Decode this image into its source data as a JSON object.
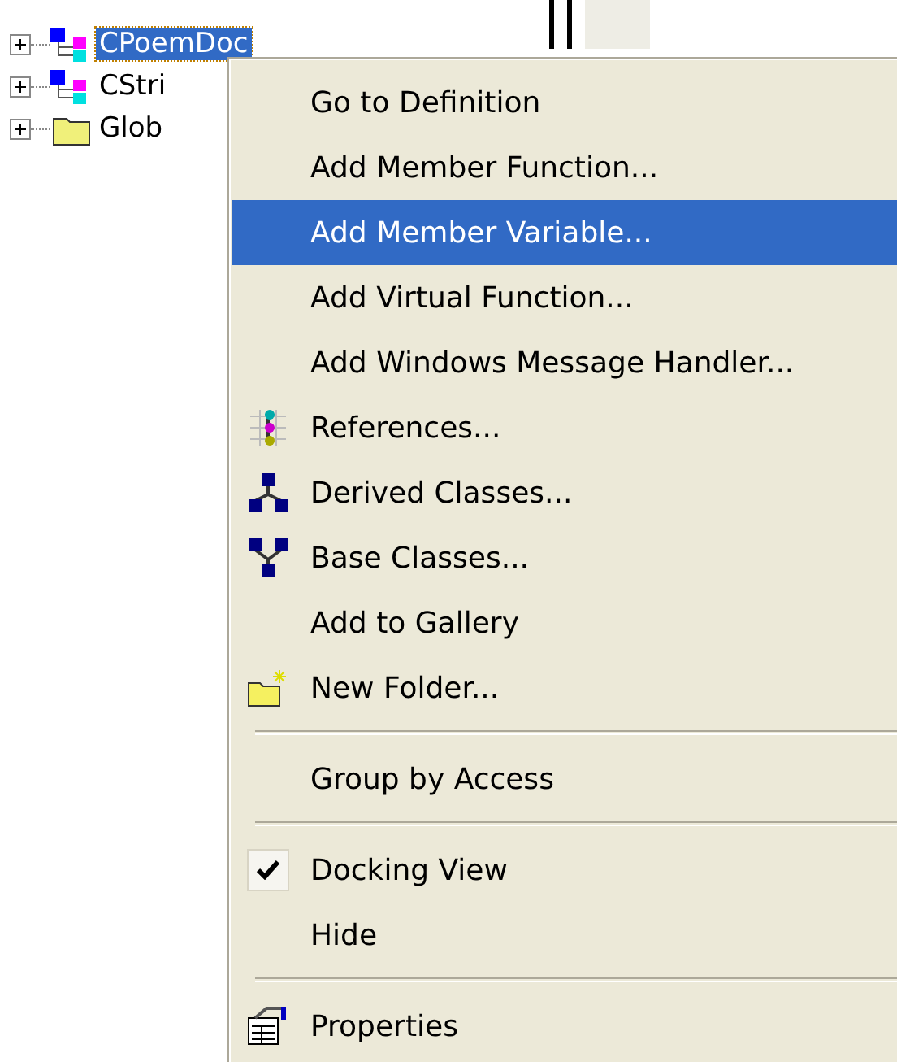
{
  "tree": {
    "items": [
      {
        "kind": "class",
        "label": "CPoemDoc",
        "selected": true,
        "expanded": false
      },
      {
        "kind": "class",
        "label": "CStri",
        "selected": false,
        "expanded": false
      },
      {
        "kind": "folder",
        "label": "Glob",
        "selected": false,
        "expanded": false
      }
    ]
  },
  "context_menu": {
    "items": [
      {
        "kind": "item",
        "label": "Go to Definition",
        "selected": false
      },
      {
        "kind": "item",
        "label": "Add Member Function...",
        "selected": false
      },
      {
        "kind": "item",
        "label": "Add Member Variable...",
        "selected": true
      },
      {
        "kind": "item",
        "label": "Add Virtual Function...",
        "selected": false
      },
      {
        "kind": "item",
        "label": "Add Windows Message Handler...",
        "selected": false
      },
      {
        "kind": "item",
        "label": "References...",
        "selected": false
      },
      {
        "kind": "item",
        "label": "Derived Classes...",
        "selected": false
      },
      {
        "kind": "item",
        "label": "Base Classes...",
        "selected": false
      },
      {
        "kind": "item",
        "label": "Add to Gallery",
        "selected": false
      },
      {
        "kind": "item",
        "label": "New Folder...",
        "selected": false
      },
      {
        "kind": "separator"
      },
      {
        "kind": "item",
        "label": "Group by Access",
        "selected": false
      },
      {
        "kind": "separator"
      },
      {
        "kind": "check",
        "label": "Docking View",
        "checked": true,
        "selected": false
      },
      {
        "kind": "item",
        "label": "Hide",
        "selected": false
      },
      {
        "kind": "separator"
      },
      {
        "kind": "item",
        "label": "Properties",
        "selected": false
      }
    ]
  }
}
